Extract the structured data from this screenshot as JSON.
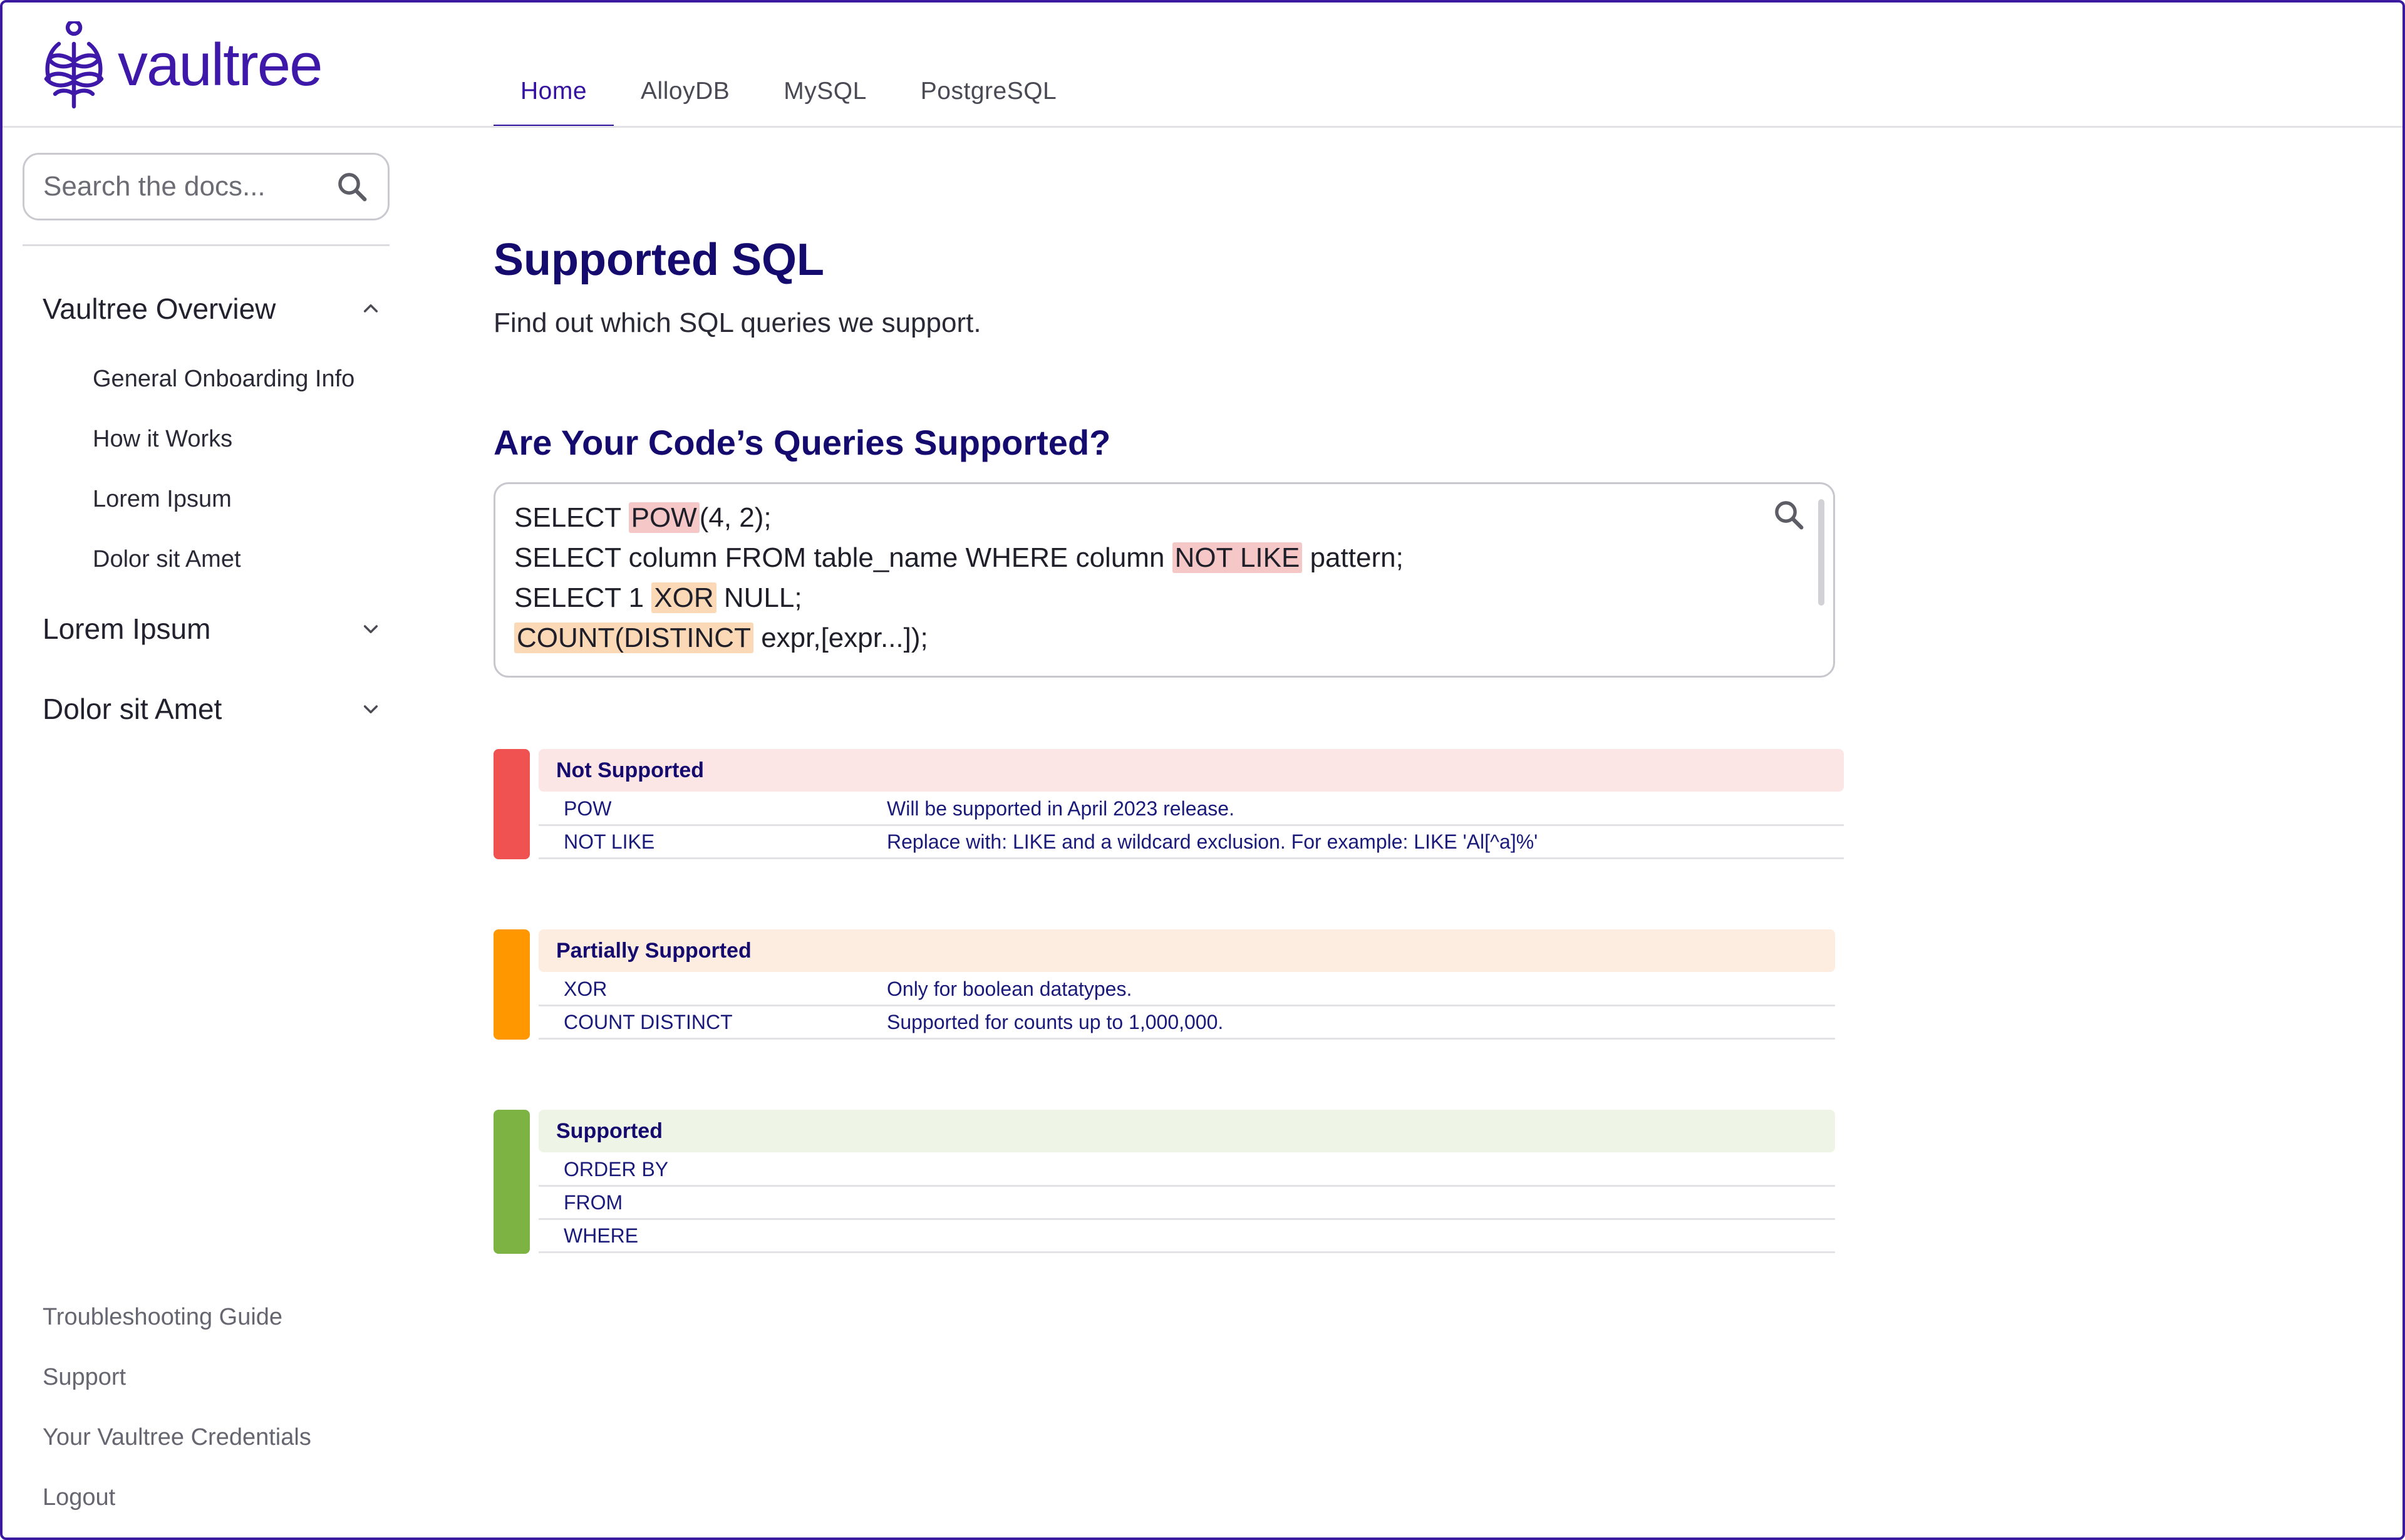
{
  "brand": {
    "name": "vaultree",
    "color": "#3e18a8"
  },
  "topnav": {
    "tabs": [
      {
        "label": "Home",
        "active": true
      },
      {
        "label": "AlloyDB",
        "active": false
      },
      {
        "label": "MySQL",
        "active": false
      },
      {
        "label": "PostgreSQL",
        "active": false
      }
    ]
  },
  "sidebar": {
    "search_placeholder": "Search the docs...",
    "sections": [
      {
        "label": "Vaultree Overview",
        "expanded": true,
        "items": [
          "General Onboarding Info",
          "How it Works",
          "Lorem Ipsum",
          "Dolor sit Amet"
        ]
      },
      {
        "label": "Lorem Ipsum",
        "expanded": false,
        "items": []
      },
      {
        "label": "Dolor sit Amet",
        "expanded": false,
        "items": []
      }
    ],
    "footer_links": [
      "Troubleshooting Guide",
      "Support",
      "Your Vaultree Credentials",
      "Logout"
    ]
  },
  "main": {
    "title": "Supported SQL",
    "subtitle": "Find out which SQL queries we support.",
    "query_heading": "Are Your Code’s Queries Supported?",
    "code_lines": [
      [
        {
          "text": "SELECT "
        },
        {
          "text": "POW",
          "hl": "red"
        },
        {
          "text": "(4, 2);"
        }
      ],
      [
        {
          "text": "SELECT column FROM table_name WHERE column "
        },
        {
          "text": "NOT LIKE",
          "hl": "red"
        },
        {
          "text": " pattern;"
        }
      ],
      [
        {
          "text": "SELECT 1 "
        },
        {
          "text": "XOR",
          "hl": "orange"
        },
        {
          "text": " NULL;"
        }
      ],
      [
        {
          "text": "COUNT(DISTINCT",
          "hl": "orange"
        },
        {
          "text": " expr,[expr...]);"
        }
      ]
    ],
    "groups": [
      {
        "title": "Not Supported",
        "bar_color": "#f05252",
        "head_bg": "#fbe5e5",
        "rows": [
          {
            "name": "POW",
            "note": "Will be supported in April 2023 release."
          },
          {
            "name": "NOT LIKE",
            "note": "Replace with: LIKE and a wildcard exclusion. For example: LIKE 'Al[^a]%'"
          }
        ]
      },
      {
        "title": "Partially Supported",
        "bar_color": "#ff9800",
        "head_bg": "#fdece0",
        "rows": [
          {
            "name": "XOR",
            "note": "Only for boolean datatypes."
          },
          {
            "name": "COUNT DISTINCT",
            "note": "Supported for counts up to 1,000,000."
          }
        ]
      },
      {
        "title": "Supported",
        "bar_color": "#7cb342",
        "head_bg": "#eef5e6",
        "rows": [
          {
            "name": "ORDER BY",
            "note": ""
          },
          {
            "name": "FROM",
            "note": ""
          },
          {
            "name": "WHERE",
            "note": ""
          }
        ]
      }
    ]
  },
  "icons": {
    "logo": "tree-logo-icon",
    "search": "search-icon",
    "expand": "chevron-down-icon",
    "collapse": "chevron-up-icon"
  }
}
